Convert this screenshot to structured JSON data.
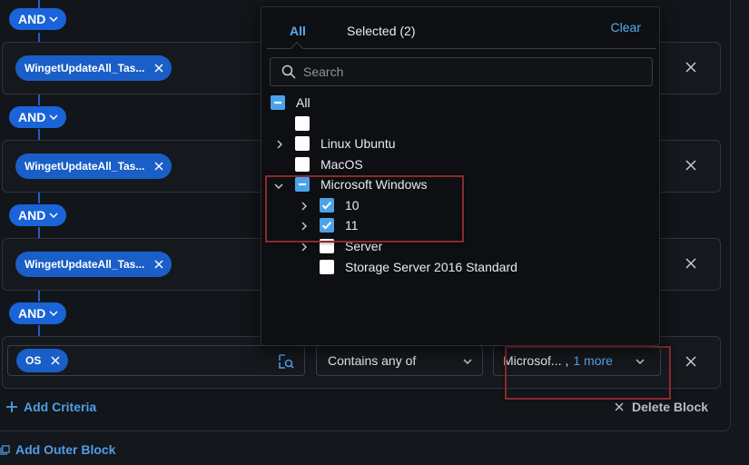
{
  "and_label": "AND",
  "rows": [
    {
      "chip": "WingetUpdateAll_Tas..."
    },
    {
      "chip": "WingetUpdateAll_Tas..."
    },
    {
      "chip": "WingetUpdateAll_Tas..."
    }
  ],
  "os_row": {
    "chip": "OS",
    "operator": "Contains any of",
    "value": "Microsof... ,",
    "value_more": "1 more"
  },
  "add_criteria_label": "Add Criteria",
  "delete_block_label": "Delete Block",
  "add_outer_block_label": "Add Outer Block",
  "dropdown": {
    "tabs": {
      "all": "All",
      "selected": "Selected (2)"
    },
    "clear": "Clear",
    "search_placeholder": "Search",
    "items": {
      "all": "All",
      "blank": "",
      "linux": "Linux Ubuntu",
      "macos": "MacOS",
      "windows": "Microsoft Windows",
      "win10": "10",
      "win11": "11",
      "server": "Server",
      "storage": "Storage Server 2016 Standard"
    }
  },
  "colors": {
    "accent": "#1a63d8",
    "checkbox": "#4aa3ea",
    "link": "#4f9ee8",
    "highlight": "#8a2a2d"
  }
}
